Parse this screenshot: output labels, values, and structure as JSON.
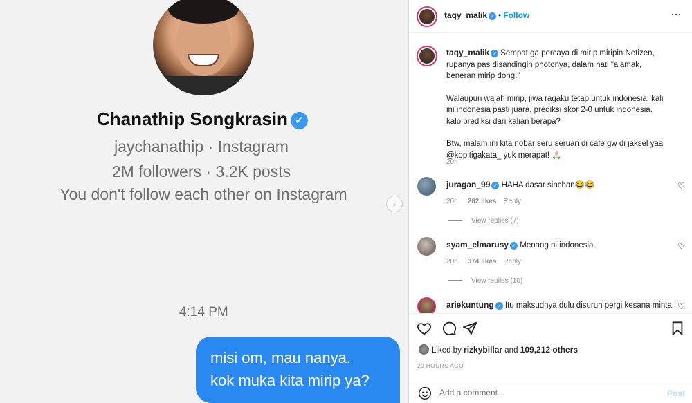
{
  "dm": {
    "name": "Chanathip Songkrasin",
    "handle_line": "jaychanathip · Instagram",
    "stats_line": "2M followers · 3.2K posts",
    "follow_line": "You don't follow each other on Instagram",
    "time": "4:14 PM",
    "message_line1": "misi om, mau nanya.",
    "message_line2": "kok muka kita mirip ya?"
  },
  "post": {
    "owner": "taqy_malik",
    "separator": "•",
    "follow_label": "Follow",
    "more_label": "···",
    "caption_p1": "Sempat ga percaya di mirip miripin Netizen, rupanya pas disandingin photonya, dalam hati \"alamak, beneran mirip dong.\"",
    "caption_p2": "Walaupun wajah mirip, jiwa ragaku tetap untuk indonesia, kali ini indonesia pasti juara, prediksi skor 2-0 untuk indonesia. kalo prediksi dari kalian berapa?",
    "caption_p3": "Btw, malam ini kita nobar seru seruan di cafe gw di jaksel yaa @kopitigakata_ yuk merapat! 🙏🏻",
    "caption_time": "20h"
  },
  "comments": [
    {
      "user": "juragan_99",
      "text": "HAHA dasar sinchan😂😂",
      "time": "20h",
      "likes": "262 likes",
      "reply_label": "Reply",
      "view_replies": "View replies (7)"
    },
    {
      "user": "syam_elmarusy",
      "text": "Menang ni indonesia",
      "time": "20h",
      "likes": "374 likes",
      "reply_label": "Reply",
      "view_replies": "View replies (10)"
    },
    {
      "user": "ariekuntung",
      "text": "Itu maksudnya dulu disuruh pergi kesana minta"
    }
  ],
  "engagement": {
    "liked_prefix": "Liked by",
    "liked_user": "rizkybillar",
    "liked_suffix": "and",
    "liked_count": "109,212 others",
    "post_age": "20 HOURS AGO"
  },
  "composer": {
    "placeholder": "Add a comment...",
    "post_label": "Post"
  },
  "icons": [
    "verified-badge-icon",
    "more-options-icon",
    "heart-icon",
    "comment-icon",
    "share-icon",
    "save-icon",
    "emoji-icon",
    "chevron-right-icon"
  ],
  "colors": {
    "accent": "#0095f6",
    "bubble": "#2a89f0",
    "verified": "#3897f0",
    "story_ring": "#e1306c"
  }
}
